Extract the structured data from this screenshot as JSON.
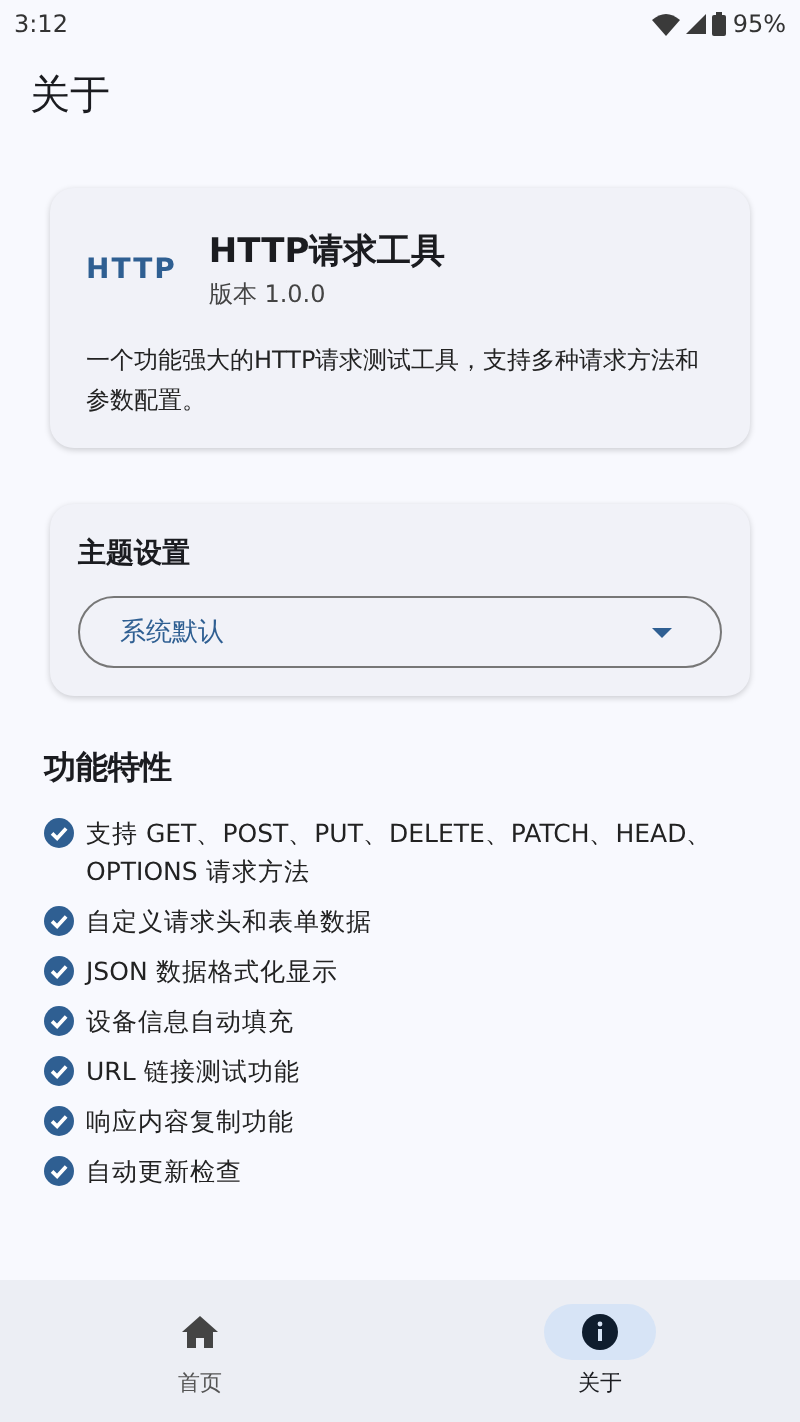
{
  "status_bar": {
    "time": "3:12",
    "battery": "95%"
  },
  "title": "关于",
  "app_card": {
    "logo": "HTTP",
    "name": "HTTP请求工具",
    "version": "版本 1.0.0",
    "description": "一个功能强大的HTTP请求测试工具，支持多种请求方法和参数配置。"
  },
  "theme_card": {
    "title": "主题设置",
    "dropdown": {
      "value": "系统默认"
    }
  },
  "features": {
    "title": "功能特性",
    "items": [
      {
        "text": "支持 GET、POST、PUT、DELETE、PATCH、HEAD、OPTIONS 请求方法"
      },
      {
        "text": "自定义请求头和表单数据"
      },
      {
        "text": "JSON 数据格式化显示"
      },
      {
        "text": "设备信息自动填充"
      },
      {
        "text": "URL 链接测试功能"
      },
      {
        "text": "响应内容复制功能"
      },
      {
        "text": "自动更新检查"
      }
    ]
  },
  "bottom_nav": [
    {
      "label": "首页",
      "kind": "home",
      "selected": false
    },
    {
      "label": "关于",
      "kind": "info",
      "selected": true
    }
  ]
}
